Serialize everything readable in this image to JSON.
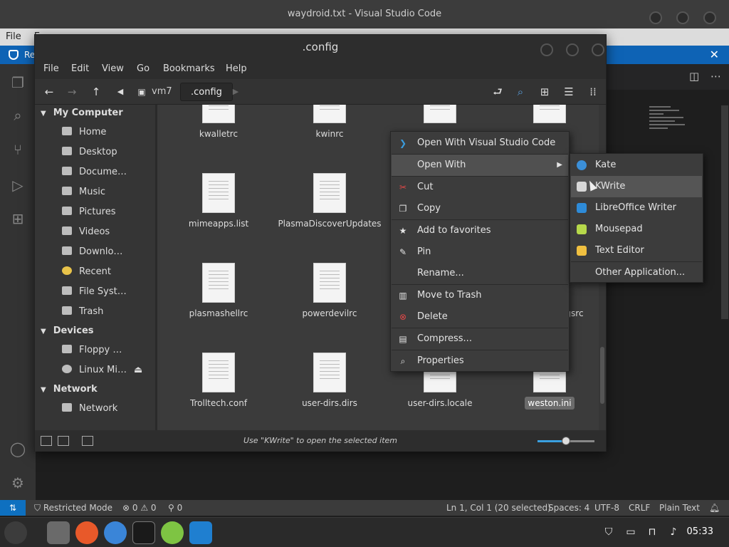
{
  "vscode": {
    "title": "waydroid.txt - Visual Studio Code",
    "menu_file": "File",
    "menu_partial": "E",
    "banner_text": "Re",
    "status": {
      "restricted": "Restricted Mode",
      "errors": "0",
      "warnings": "0",
      "ports": "0",
      "position": "Ln 1, Col 1 (20 selected)",
      "spaces": "Spaces: 4",
      "encoding": "UTF-8",
      "eol": "CRLF",
      "language": "Plain Text"
    }
  },
  "filemanager": {
    "title": ".config",
    "menu": [
      "File",
      "Edit",
      "View",
      "Go",
      "Bookmarks",
      "Help"
    ],
    "breadcrumb": {
      "parent": "vm7",
      "current": ".config"
    },
    "sidebar": {
      "my_computer": "My Computer",
      "places": [
        "Home",
        "Desktop",
        "Docume…",
        "Music",
        "Pictures",
        "Videos",
        "Downlo…",
        "Recent",
        "File Syst…",
        "Trash"
      ],
      "devices": "Devices",
      "device_items": [
        "Floppy …",
        "Linux Mi…"
      ],
      "network": "Network",
      "network_items": [
        "Network"
      ]
    },
    "files": {
      "r0": [
        "kwalletrc",
        "kwinrc"
      ],
      "r1": [
        "mimeapps.list",
        "PlasmaDiscoverUpdates"
      ],
      "r2": [
        "plasmashellrc",
        "powerdevilrc"
      ],
      "r2_partial": "gsrc",
      "r3": [
        "Trolltech.conf",
        "user-dirs.dirs",
        "user-dirs.locale",
        "weston.ini"
      ]
    },
    "status_text": "Use \"KWrite\" to open the selected item",
    "zoom_level": 0.5
  },
  "context_menu": {
    "items": [
      "Open With Visual Studio Code",
      "Open With",
      "Cut",
      "Copy",
      "Add to favorites",
      "Pin",
      "Rename...",
      "Move to Trash",
      "Delete",
      "Compress...",
      "Properties"
    ]
  },
  "submenu": {
    "items": [
      "Kate",
      "KWrite",
      "LibreOffice Writer",
      "Mousepad",
      "Text Editor",
      "Other Application..."
    ]
  },
  "taskbar": {
    "clock": "05:33"
  },
  "colors": {
    "accent": "#0e63b5",
    "status_remote": "#0e70c0"
  }
}
